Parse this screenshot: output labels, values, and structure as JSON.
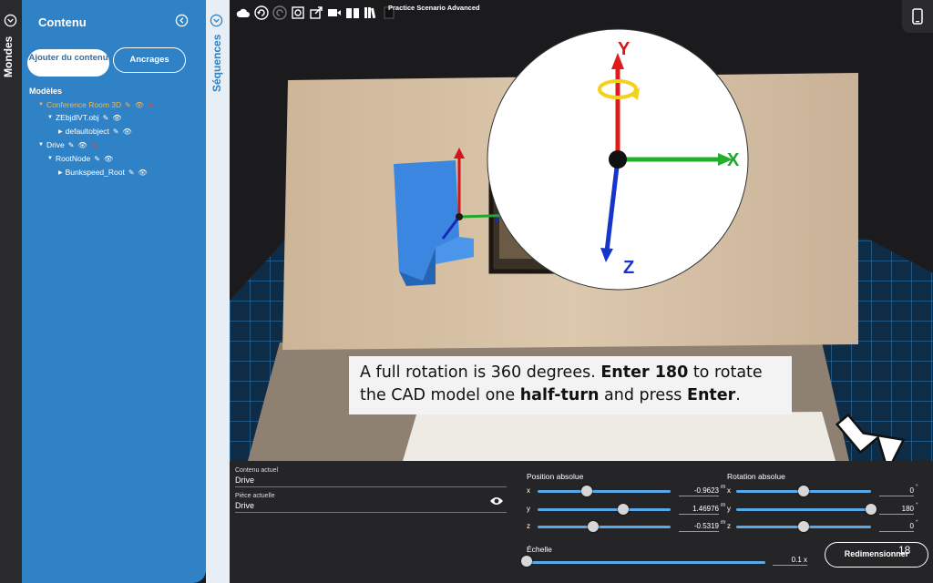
{
  "rails": {
    "worlds_label": "Mondes",
    "sequences_label": "Séquences"
  },
  "content_panel": {
    "title": "Contenu",
    "add_content_label": "Ajouter du contenu",
    "anchors_label": "Ancrages",
    "models_heading": "Modèles",
    "tree": [
      {
        "label": "Conference Room 3D",
        "level": 1,
        "expanded": true,
        "highlight": true,
        "icons": [
          "edit-icon",
          "eye-icon",
          "delete-icon"
        ]
      },
      {
        "label": "ZEbjdlVT.obj",
        "level": 2,
        "expanded": true,
        "highlight": false,
        "icons": [
          "edit-icon",
          "eye-icon"
        ]
      },
      {
        "label": "defaultobject",
        "level": 3,
        "expanded": false,
        "highlight": false,
        "icons": [
          "edit-icon",
          "eye-icon"
        ]
      },
      {
        "label": "Drive",
        "level": 1,
        "expanded": true,
        "highlight": false,
        "icons": [
          "edit-icon",
          "eye-icon",
          "delete-icon"
        ]
      },
      {
        "label": "RootNode",
        "level": 2,
        "expanded": true,
        "highlight": false,
        "icons": [
          "edit-icon",
          "eye-icon"
        ]
      },
      {
        "label": "Bunkspeed_Root",
        "level": 3,
        "expanded": false,
        "highlight": false,
        "icons": [
          "edit-icon",
          "eye-icon"
        ]
      }
    ]
  },
  "toolbar": {
    "icons": [
      "cloud-save-icon",
      "undo-icon",
      "redo-icon",
      "capture-icon",
      "share-icon",
      "video-icon",
      "book-icon",
      "library-icon",
      "dark-book-icon"
    ],
    "scenario_title": "Practice Scenario Advanced"
  },
  "gizmo": {
    "axis_y": "Y",
    "axis_x": "X",
    "axis_z": "Z",
    "colors": {
      "x": "#22b02a",
      "y": "#e01b1b",
      "z": "#1736c9",
      "ring": "#f2d21a"
    }
  },
  "instruction": {
    "part1": "A full rotation is 360 degrees. ",
    "bold1": "Enter 180",
    "part2": " to rotate the CAD model one ",
    "bold2": "half-turn",
    "part3": " and press ",
    "bold3": "Enter",
    "part4": "."
  },
  "properties": {
    "current_content_label": "Contenu actuel",
    "current_content_value": "Drive",
    "current_part_label": "Pièce actuelle",
    "current_part_value": "Drive",
    "position": {
      "label": "Position absolue",
      "unit": "m",
      "x": {
        "axis": "x",
        "value": "-0.9623"
      },
      "y": {
        "axis": "y",
        "value": "1.46976"
      },
      "z": {
        "axis": "z",
        "value": "-0.5319"
      }
    },
    "rotation": {
      "label": "Rotation absolue",
      "unit": "°",
      "x": {
        "axis": "x",
        "value": "0"
      },
      "y": {
        "axis": "y",
        "value": "180"
      },
      "z": {
        "axis": "z",
        "value": "0"
      }
    },
    "scale": {
      "label": "Échelle",
      "value": "0.1 x"
    },
    "resize_label": "Redimensionner",
    "page_number": "18"
  }
}
